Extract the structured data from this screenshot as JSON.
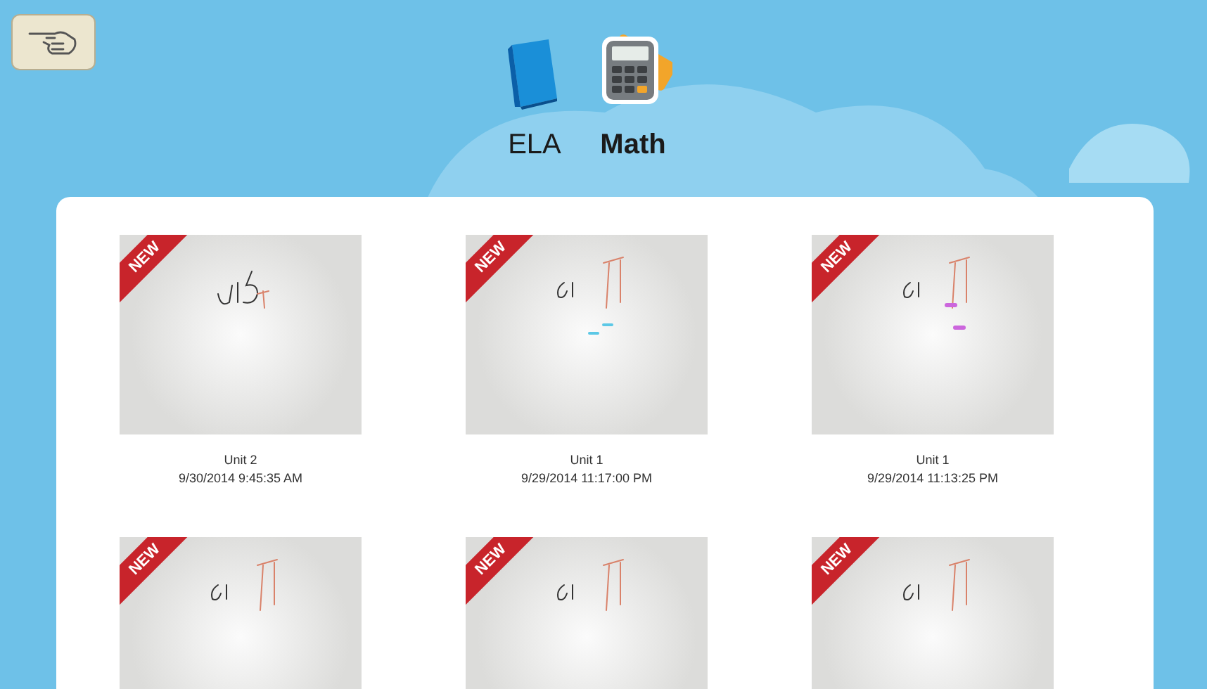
{
  "subjects": [
    {
      "label": "ELA",
      "selected": false,
      "kind": "book"
    },
    {
      "label": "Math",
      "selected": true,
      "kind": "calculator"
    }
  ],
  "drawings": [
    {
      "badge": "NEW",
      "title": "Unit 2",
      "date": "9/30/2014 9:45:35 AM"
    },
    {
      "badge": "NEW",
      "title": "Unit 1",
      "date": "9/29/2014 11:17:00 PM"
    },
    {
      "badge": "NEW",
      "title": "Unit 1",
      "date": "9/29/2014 11:13:25 PM"
    },
    {
      "badge": "NEW"
    },
    {
      "badge": "NEW"
    },
    {
      "badge": "NEW"
    }
  ]
}
